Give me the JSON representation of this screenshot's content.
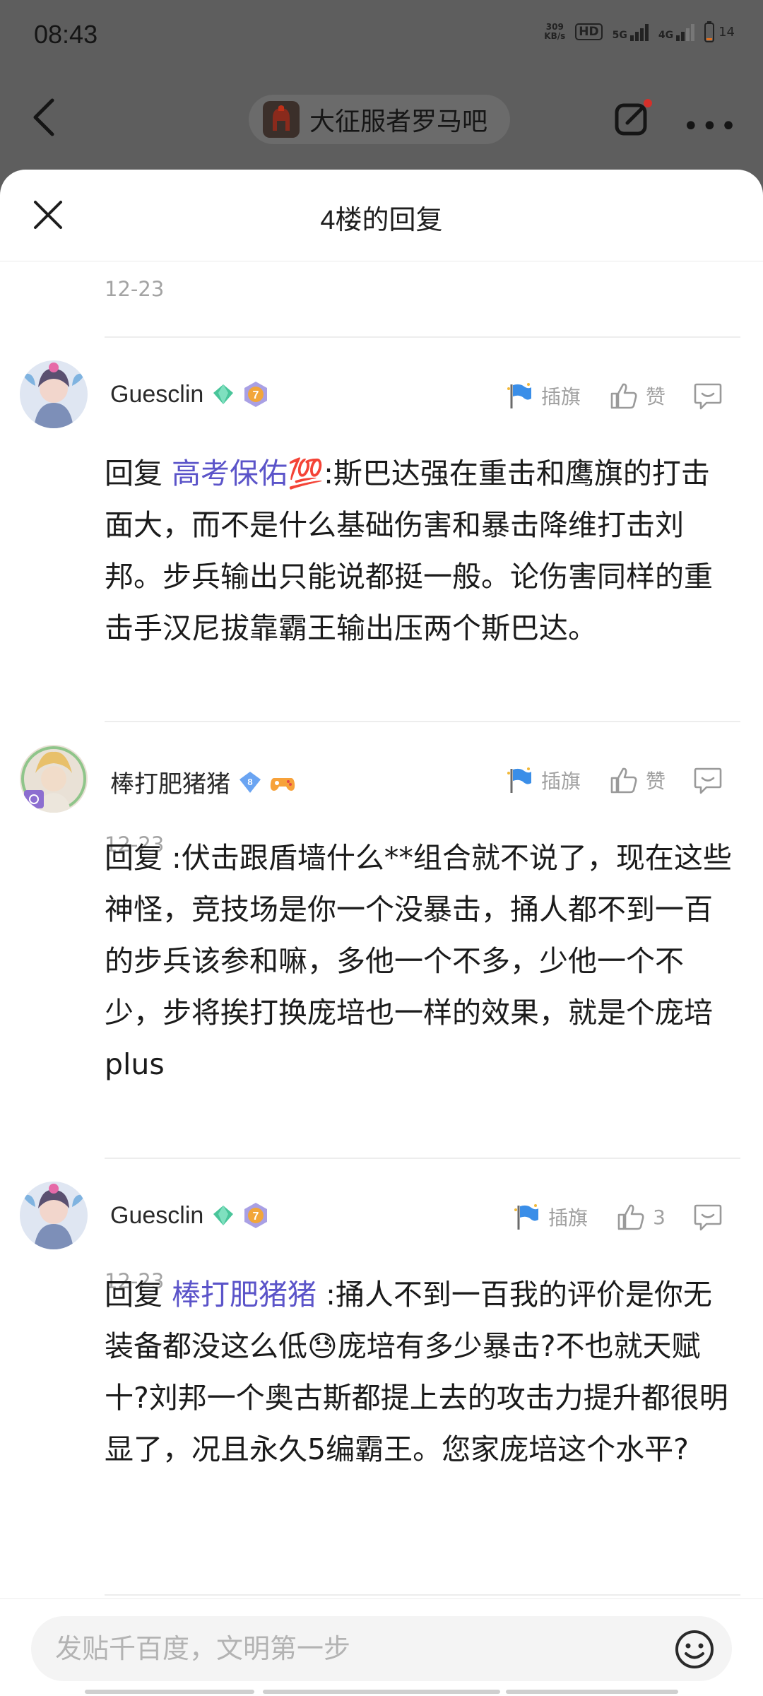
{
  "status_bar": {
    "time": "08:43",
    "net_speed_value": "309",
    "net_speed_unit": "KB/s",
    "hd_label": "HD",
    "sim1_label": "5G",
    "sim2_label": "4G",
    "battery": "14"
  },
  "top_nav": {
    "forum_name": "大征服者罗马吧"
  },
  "sheet": {
    "title": "4楼的回复",
    "first_date": "12-23"
  },
  "replies": [
    {
      "username": "Guesclin",
      "level": "7",
      "prefix": "回复 ",
      "mention": "高考保佑💯",
      "text": ":斯巴达强在重击和鹰旗的打击面大，而不是什么基础伤害和暴击降维打击刘邦。步兵输出只能说都挺一般。论伤害同样的重击手汉尼拔靠霸王输出压两个斯巴达。",
      "date": "12-23",
      "flag_label": "插旗",
      "like_label": "赞"
    },
    {
      "username": "棒打肥猪猪",
      "level": "8",
      "prefix": "回复 ",
      "mention": "",
      "text": " :伏击跟盾墙什么**组合就不说了，现在这些神怪，竞技场是你一个没暴击，捅人都不到一百的步兵该参和嘛，多他一个不多，少他一个不少，步将挨打换庞培也一样的效果，就是个庞培plus",
      "date": "12-23",
      "flag_label": "插旗",
      "like_label": "赞"
    },
    {
      "username": "Guesclin",
      "level": "7",
      "prefix": "回复 ",
      "mention": "棒打肥猪猪",
      "text": " :捅人不到一百我的评价是你无装备都没这么低😓庞培有多少暴击?不也就天赋十?刘邦一个奥古斯都提上去的攻击力提升都很明显了，况且永久5编霸王。您家庞培这个水平?",
      "date": "12-23",
      "flag_label": "插旗",
      "like_label": "3"
    }
  ],
  "bottom": {
    "placeholder": "发贴千百度，文明第一步"
  },
  "colors": {
    "mention": "#5b54c9",
    "overlay": "#5e5e5e",
    "meta_gray": "#a3a3a3"
  }
}
